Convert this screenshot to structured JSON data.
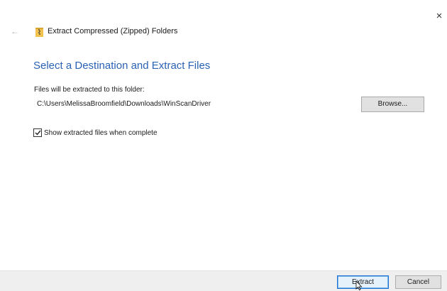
{
  "window": {
    "title": "Extract Compressed (Zipped) Folders",
    "close_glyph": "×",
    "back_glyph": "←",
    "title_icon": "zip-folder-icon"
  },
  "main": {
    "heading": "Select a Destination and Extract Files",
    "dest_label": "Files will be extracted to this folder:",
    "dest_path": "C:\\Users\\MelissaBroomfield\\Downloads\\WinScanDriver",
    "browse_label": "Browse...",
    "show_files_label": "Show extracted files when complete",
    "show_files_checked": true
  },
  "footer": {
    "extract_label": "Extract",
    "cancel_label": "Cancel"
  },
  "colors": {
    "heading": "#2a62b5",
    "footer_bg": "#efefef",
    "default_button_border": "#1e73d2",
    "folder_yellow": "#f2c14e"
  }
}
